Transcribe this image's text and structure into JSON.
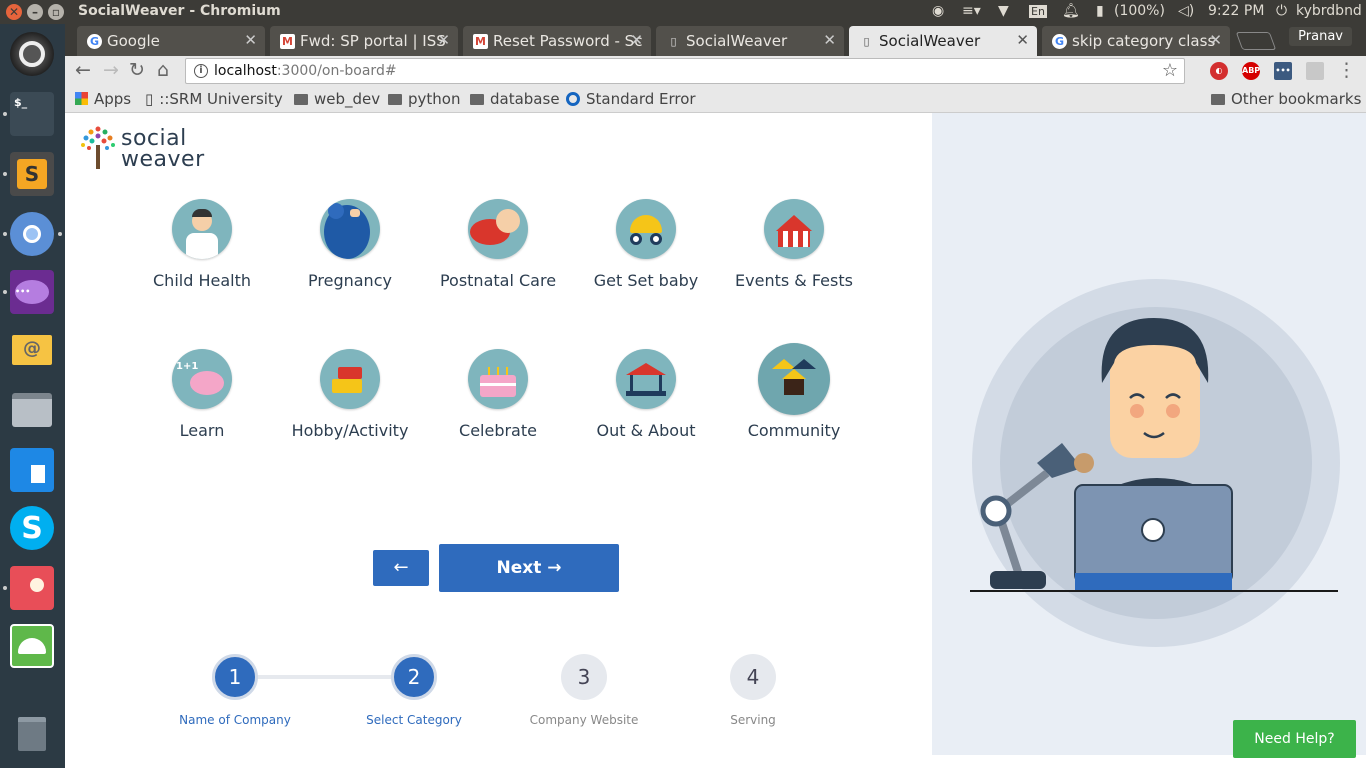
{
  "system": {
    "window_title": "SocialWeaver - Chromium",
    "keyboard_layout": "En",
    "battery": "(100%)",
    "time": "9:22 PM",
    "user": "kybrdbnd"
  },
  "browser": {
    "tabs": [
      {
        "title": "Google",
        "icon": "google-icon"
      },
      {
        "title": "Fwd: SP portal | ISS",
        "icon": "gmail-icon"
      },
      {
        "title": "Reset Password - Sc",
        "icon": "gmail-icon"
      },
      {
        "title": "SocialWeaver",
        "icon": "page-icon"
      },
      {
        "title": "SocialWeaver",
        "icon": "page-icon",
        "active": true
      },
      {
        "title": "skip category class",
        "icon": "google-icon"
      }
    ],
    "profile": "Pranav",
    "url_host": "localhost",
    "url_rest": ":3000/on-board#",
    "bookmarks": [
      "Apps",
      "::SRM University",
      "web_dev",
      "python",
      "database",
      "Standard Error R"
    ],
    "other_bookmarks": "Other bookmarks",
    "extensions": {
      "abp": "ABP"
    }
  },
  "logo": {
    "line1": "social",
    "line2": "weaver"
  },
  "categories": [
    {
      "label": "Child Health",
      "icon": "doctor-icon"
    },
    {
      "label": "Pregnancy",
      "icon": "pregnancy-icon"
    },
    {
      "label": "Postnatal Care",
      "icon": "baby-icon"
    },
    {
      "label": "Get Set baby",
      "icon": "stroller-icon"
    },
    {
      "label": "Events & Fests",
      "icon": "circus-tent-icon"
    },
    {
      "label": "Learn",
      "icon": "brain-icon"
    },
    {
      "label": "Hobby/Activity",
      "icon": "lego-bricks-icon"
    },
    {
      "label": "Celebrate",
      "icon": "cake-icon"
    },
    {
      "label": "Out & About",
      "icon": "carousel-icon"
    },
    {
      "label": "Community",
      "icon": "houses-icon",
      "selected": true
    }
  ],
  "buttons": {
    "back": "←",
    "next": "Next →"
  },
  "steps": [
    {
      "num": "1",
      "label": "Name of Company",
      "done": true
    },
    {
      "num": "2",
      "label": "Select Category",
      "done": true
    },
    {
      "num": "3",
      "label": "Company Website",
      "done": false
    },
    {
      "num": "4",
      "label": "Serving",
      "done": false
    }
  ],
  "help": "Need Help?",
  "colors": {
    "primary": "#2f6bbd",
    "help": "#3cb34a",
    "circle": "#7fb5bd",
    "panel": "#e9eef5"
  }
}
